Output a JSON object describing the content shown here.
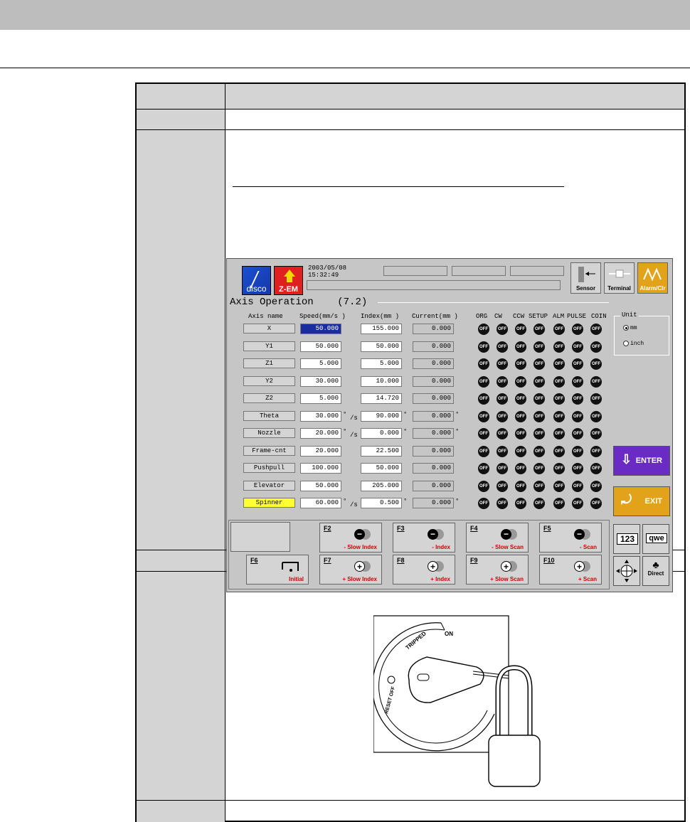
{
  "screen": {
    "datetime": "2003/05/08 15:32:49",
    "logo_disco": "disco",
    "logo_zem": "Z-EM",
    "toolbar": {
      "sensor": "Sensor",
      "terminal": "Terminal",
      "alarm": "Alarm/Clr"
    },
    "title": "Axis Operation",
    "title_num": "(7.2)",
    "headers": {
      "axis": "Axis name",
      "speed": "Speed(mm/s  )",
      "index": "Index(mm  )",
      "current": "Current(mm  )",
      "org": "ORG",
      "cw": "CW",
      "ccw": "CCW",
      "setup": "SETUP",
      "alm": "ALM",
      "pulse": "PULSE",
      "coin": "COIN"
    },
    "axes": [
      {
        "name": "X",
        "speed": "50.000",
        "index": "155.000",
        "current": "0.000"
      },
      {
        "name": "Y1",
        "speed": "50.000",
        "index": "50.000",
        "current": "0.000"
      },
      {
        "name": "Z1",
        "speed": "5.000",
        "index": "5.000",
        "current": "0.000"
      },
      {
        "name": "Y2",
        "speed": "30.000",
        "index": "10.000",
        "current": "0.000"
      },
      {
        "name": "Z2",
        "speed": "5.000",
        "index": "14.720",
        "current": "0.000"
      },
      {
        "name": "Theta",
        "speed": "30.000",
        "index": "90.000",
        "current": "0.000"
      },
      {
        "name": "Nozzle",
        "speed": "20.000",
        "index": "0.000",
        "current": "0.000"
      },
      {
        "name": "Frame-cnt",
        "speed": "20.000",
        "index": "22.500",
        "current": "0.000"
      },
      {
        "name": "Pushpull",
        "speed": "100.000",
        "index": "50.000",
        "current": "0.000"
      },
      {
        "name": "Elevator",
        "speed": "50.000",
        "index": "205.000",
        "current": "0.000"
      },
      {
        "name": "Spinner",
        "speed": "60.000",
        "index": "0.500",
        "current": "0.000"
      }
    ],
    "led_label": "OFF",
    "deg": "°",
    "per_s": "/s",
    "unit": {
      "title": "Unit",
      "mm": "mm",
      "inch": "inch"
    },
    "enter": "ENTER",
    "exit": "EXIT",
    "fkeys": [
      {
        "key": "F2",
        "label": "- Slow Index"
      },
      {
        "key": "F3",
        "label": "- Index"
      },
      {
        "key": "F4",
        "label": "- Slow Scan"
      },
      {
        "key": "F5",
        "label": "- Scan"
      },
      {
        "key": "F6",
        "label": "Initial"
      },
      {
        "key": "F7",
        "label": "+ Slow Index"
      },
      {
        "key": "F8",
        "label": "+ Index"
      },
      {
        "key": "F9",
        "label": "+ Slow Scan"
      },
      {
        "key": "F10",
        "label": "+ Scan"
      }
    ],
    "keypad": {
      "num": "123",
      "qwe": "qwe",
      "direct": "Direct"
    }
  },
  "breaker": {
    "on": "ON",
    "tripped": "TRIPPED",
    "reset_off": "RESET OFF"
  }
}
